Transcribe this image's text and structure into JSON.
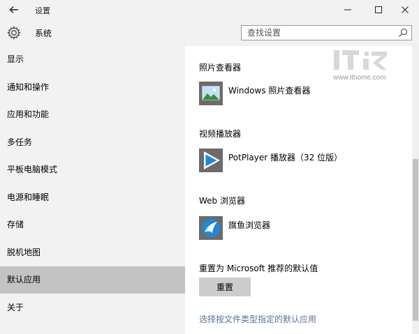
{
  "window": {
    "title": "设置",
    "back_icon": "arrow-left-icon",
    "minimize_glyph": "—",
    "maximize_glyph": "☐",
    "close_glyph": "✕"
  },
  "header": {
    "title": "系统",
    "icon": "gear-icon",
    "search_placeholder": "查找设置"
  },
  "sidebar": {
    "items": [
      {
        "label": "显示",
        "active": false
      },
      {
        "label": "通知和操作",
        "active": false
      },
      {
        "label": "应用和功能",
        "active": false
      },
      {
        "label": "多任务",
        "active": false
      },
      {
        "label": "平板电脑模式",
        "active": false
      },
      {
        "label": "电源和睡眠",
        "active": false
      },
      {
        "label": "存储",
        "active": false
      },
      {
        "label": "脱机地图",
        "active": false
      },
      {
        "label": "默认应用",
        "active": true
      },
      {
        "label": "关于",
        "active": false
      }
    ]
  },
  "content": {
    "photo": {
      "label": "照片查看器",
      "app": "Windows 照片查看器",
      "icon": "photo-viewer-icon"
    },
    "video": {
      "label": "视频播放器",
      "app": "PotPlayer 播放器（32 位版）",
      "icon": "play-icon"
    },
    "browser": {
      "label": "Web 浏览器",
      "app": "旗鱼浏览器",
      "icon": "sailfish-browser-icon"
    },
    "reset_label": "重置为 Microsoft 推荐的默认值",
    "reset_button": "重置",
    "link_text": "选择按文件类型指定的默认应用"
  },
  "watermark": {
    "logo_text": "IT之家",
    "url": "www.ithome.com"
  },
  "colors": {
    "chrome": "#f2f2f2",
    "active_item": "#c3c3c3",
    "accent_blue": "#1f88d9",
    "link": "#5a7396"
  }
}
